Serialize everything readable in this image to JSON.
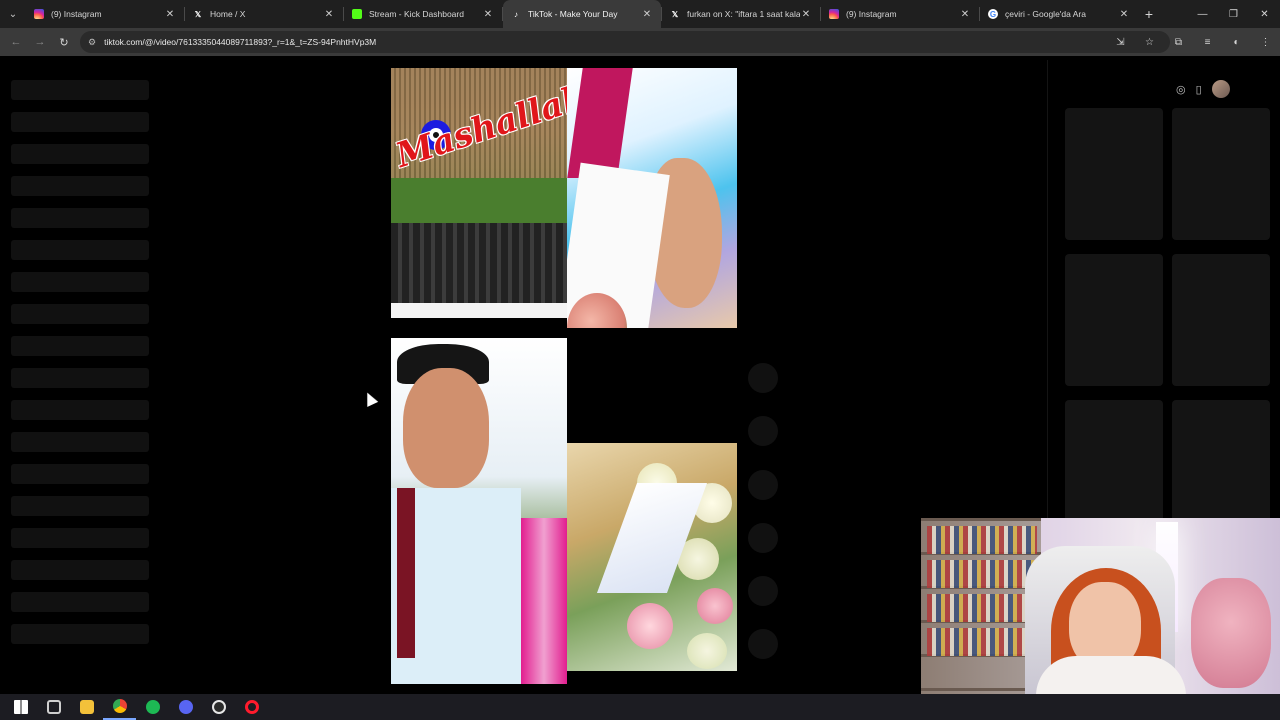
{
  "browser": {
    "tabs": [
      {
        "title": "(9) Instagram",
        "icon": "instagram-icon",
        "color": "#e1306c",
        "active": false
      },
      {
        "title": "Home / X",
        "icon": "x-logo-icon",
        "color": "#ffffff",
        "active": false
      },
      {
        "title": "Stream - Kick Dashboard",
        "icon": "kick-icon",
        "color": "#53fc18",
        "active": false
      },
      {
        "title": "TikTok - Make Your Day",
        "icon": "tiktok-icon",
        "color": "#ffffff",
        "active": true
      },
      {
        "title": "furkan on X: \"iftara 1 saat kala",
        "icon": "x-logo-icon",
        "color": "#ffffff",
        "active": false
      },
      {
        "title": "(9) Instagram",
        "icon": "instagram-icon",
        "color": "#e1306c",
        "active": false
      },
      {
        "title": "çeviri - Google'da Ara",
        "icon": "google-icon",
        "color": "#4285f4",
        "active": false
      }
    ],
    "new_tab_symbol": "+",
    "url": "tiktok.com/@/video/7613335044089711893?_r=1&_t=ZS-94PnhtHVp3M"
  },
  "video": {
    "overlay_text": "Mashallah"
  },
  "taskbar": {
    "apps": [
      {
        "name": "windows-start-icon",
        "color": "#ffffff"
      },
      {
        "name": "task-view-icon",
        "color": "#cfcfcf"
      },
      {
        "name": "file-explorer-icon",
        "color": "#f3c13a"
      },
      {
        "name": "chrome-icon",
        "color": "#4285f4"
      },
      {
        "name": "spotify-icon",
        "color": "#1db954"
      },
      {
        "name": "discord-icon",
        "color": "#5865f2"
      },
      {
        "name": "obs-icon",
        "color": "#e6e6e6"
      },
      {
        "name": "opera-icon",
        "color": "#ff1b2d"
      }
    ]
  }
}
